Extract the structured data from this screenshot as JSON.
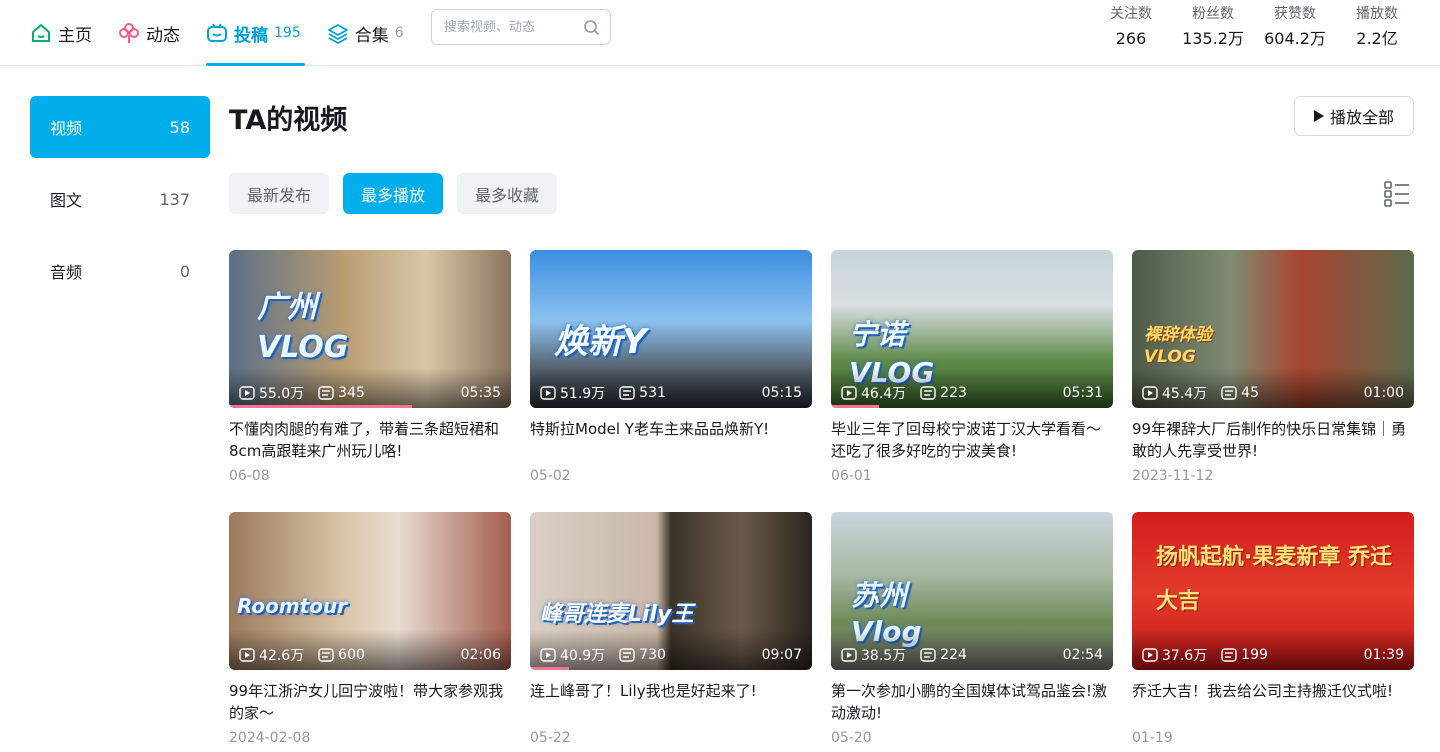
{
  "nav": {
    "home": "主页",
    "dynamic": "动态",
    "uploads": "投稿",
    "uploads_count": "195",
    "collections": "合集",
    "collections_count": "6"
  },
  "search": {
    "placeholder": "搜索视频、动态"
  },
  "stats": [
    {
      "label": "关注数",
      "value": "266"
    },
    {
      "label": "粉丝数",
      "value": "135.2万"
    },
    {
      "label": "获赞数",
      "value": "604.2万"
    },
    {
      "label": "播放数",
      "value": "2.2亿"
    }
  ],
  "sidebar": [
    {
      "label": "视频",
      "count": "58"
    },
    {
      "label": "图文",
      "count": "137"
    },
    {
      "label": "音频",
      "count": "0"
    }
  ],
  "main": {
    "title": "TA的视频",
    "play_all": "播放全部",
    "filters": [
      "最新发布",
      "最多播放",
      "最多收藏"
    ]
  },
  "videos": [
    {
      "overlay": "广州 VLOG",
      "views": "55.0万",
      "danmaku": "345",
      "duration": "05:35",
      "title": "不懂肉肉腿的有难了，带着三条超短裙和8cm高跟鞋来广州玩儿咯!",
      "date": "06-08",
      "progress": 0.65
    },
    {
      "overlay": "焕新Y",
      "views": "51.9万",
      "danmaku": "531",
      "duration": "05:15",
      "title": "特斯拉Model Y老车主来品品焕新Y!",
      "date": "05-02",
      "progress": 0
    },
    {
      "overlay": "宁诺 VLOG",
      "views": "46.4万",
      "danmaku": "223",
      "duration": "05:31",
      "title": "毕业三年了回母校宁波诺丁汉大学看看～还吃了很多好吃的宁波美食!",
      "date": "06-01",
      "progress": 0.17
    },
    {
      "overlay": "裸辞体验 VLOG",
      "views": "45.4万",
      "danmaku": "45",
      "duration": "01:00",
      "title": "99年裸辞大厂后制作的快乐日常集锦｜勇敢的人先享受世界!",
      "date": "2023-11-12",
      "progress": 0
    },
    {
      "overlay": "Roomtour",
      "views": "42.6万",
      "danmaku": "600",
      "duration": "02:06",
      "title": "99年江浙沪女儿回宁波啦！带大家参观我的家～",
      "date": "2024-02-08",
      "progress": 0
    },
    {
      "overlay": "峰哥连麦Lily王",
      "views": "40.9万",
      "danmaku": "730",
      "duration": "09:07",
      "title": "连上峰哥了！Lily我也是好起来了!",
      "date": "05-22",
      "progress": 0.14
    },
    {
      "overlay": "苏州 Vlog",
      "views": "38.5万",
      "danmaku": "224",
      "duration": "02:54",
      "title": "第一次参加小鹏的全国媒体试驾品鉴会!激动激动!",
      "date": "05-20",
      "progress": 0
    },
    {
      "overlay": "扬帆起航·果麦新章 乔迁大吉",
      "views": "37.6万",
      "danmaku": "199",
      "duration": "01:39",
      "title": "乔迁大吉！我去给公司主持搬迁仪式啦!",
      "date": "01-19",
      "progress": 0
    }
  ]
}
